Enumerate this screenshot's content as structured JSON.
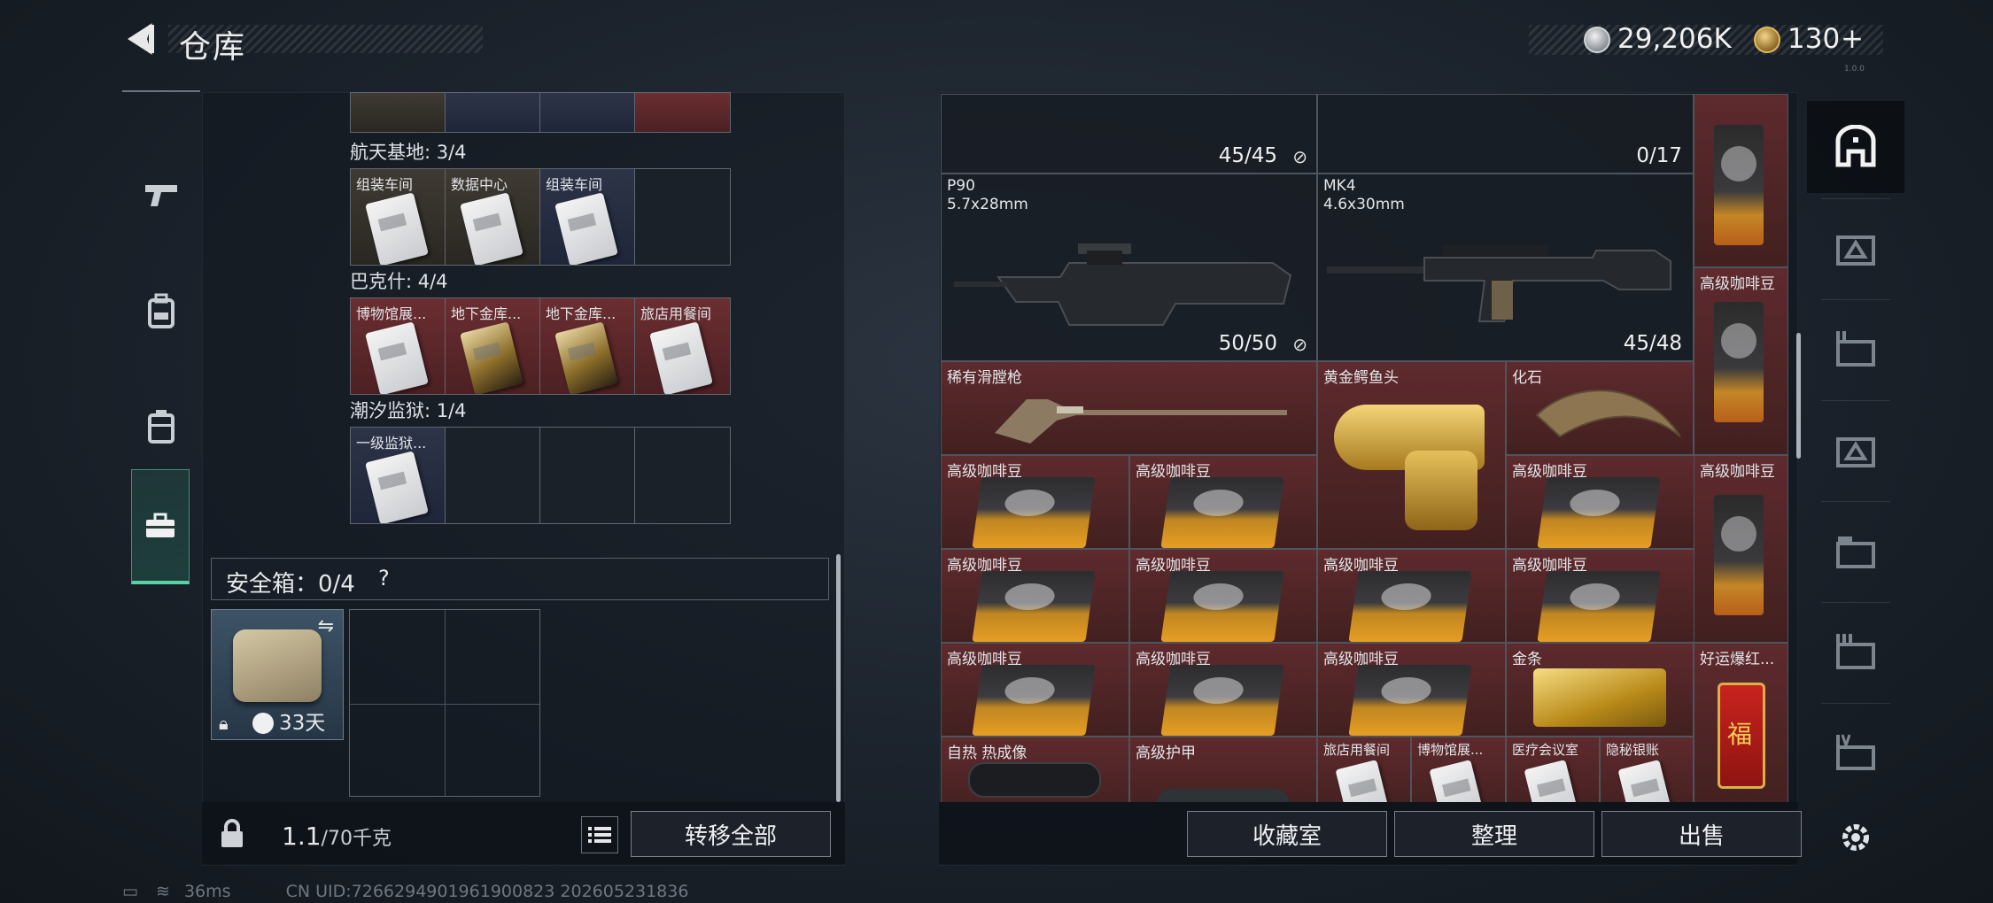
{
  "header": {
    "title": "仓库"
  },
  "currency": {
    "coins": "29,206K",
    "premium": "130",
    "plus": "+"
  },
  "version_tag": "1.0.0",
  "left_panel": {
    "maps": [
      {
        "label": "航天基地: 3/4",
        "slots": [
          {
            "name": "组装车间",
            "style": "tan",
            "card": "white"
          },
          {
            "name": "数据中心",
            "style": "tan",
            "card": "white"
          },
          {
            "name": "组装车间",
            "style": "blue",
            "card": "white"
          },
          {
            "name": "",
            "style": "empty",
            "card": ""
          }
        ]
      },
      {
        "label": "巴克什: 4/4",
        "slots": [
          {
            "name": "博物馆展...",
            "style": "red",
            "card": "white"
          },
          {
            "name": "地下金库...",
            "style": "red",
            "card": "gold"
          },
          {
            "name": "地下金库...",
            "style": "red",
            "card": "gold"
          },
          {
            "name": "旅店用餐间",
            "style": "red",
            "card": "white"
          }
        ]
      },
      {
        "label": "潮汐监狱: 1/4",
        "slots": [
          {
            "name": "一级监狱...",
            "style": "blue",
            "card": "white"
          },
          {
            "name": "",
            "style": "empty",
            "card": ""
          },
          {
            "name": "",
            "style": "empty",
            "card": ""
          },
          {
            "name": "",
            "style": "empty",
            "card": ""
          }
        ]
      }
    ],
    "safebox": {
      "label": "安全箱：0/4",
      "help": "?",
      "timer": "33天"
    },
    "weight": {
      "value": "1.1",
      "unit": "/70千克"
    },
    "transfer_all": "转移全部"
  },
  "stash": {
    "items": [
      {
        "id": "p90",
        "name": "P90",
        "sub": "5.7x28mm",
        "ammo": "50/50"
      },
      {
        "id": "mk4",
        "name": "MK4",
        "sub": "4.6x30mm",
        "ammo": "45/48"
      },
      {
        "id": "top-left-ammo",
        "ammo": "45/45"
      },
      {
        "id": "top-right-ammo",
        "ammo": "0/17"
      },
      {
        "id": "musket",
        "name": "稀有滑膛枪"
      },
      {
        "id": "croc",
        "name": "黄金鳄鱼头"
      },
      {
        "id": "fossil",
        "name": "化石"
      },
      {
        "id": "coffee",
        "name": "高级咖啡豆"
      },
      {
        "id": "gold-bar",
        "name": "金条"
      },
      {
        "id": "lucky",
        "name": "好运爆红..."
      },
      {
        "id": "thermal",
        "name": "自热 热成像"
      },
      {
        "id": "armor",
        "name": "高级护甲"
      },
      {
        "id": "k1",
        "name": "旅店用餐间"
      },
      {
        "id": "k2",
        "name": "博物馆展..."
      },
      {
        "id": "k3",
        "name": "医疗会议室"
      },
      {
        "id": "k4",
        "name": "隐秘银账"
      }
    ],
    "buttons": {
      "collection": "收藏室",
      "sort": "整理",
      "sell": "出售"
    }
  },
  "status": {
    "ping": "36ms",
    "uid": "CN UID:7266294901961900823  202605231836"
  }
}
